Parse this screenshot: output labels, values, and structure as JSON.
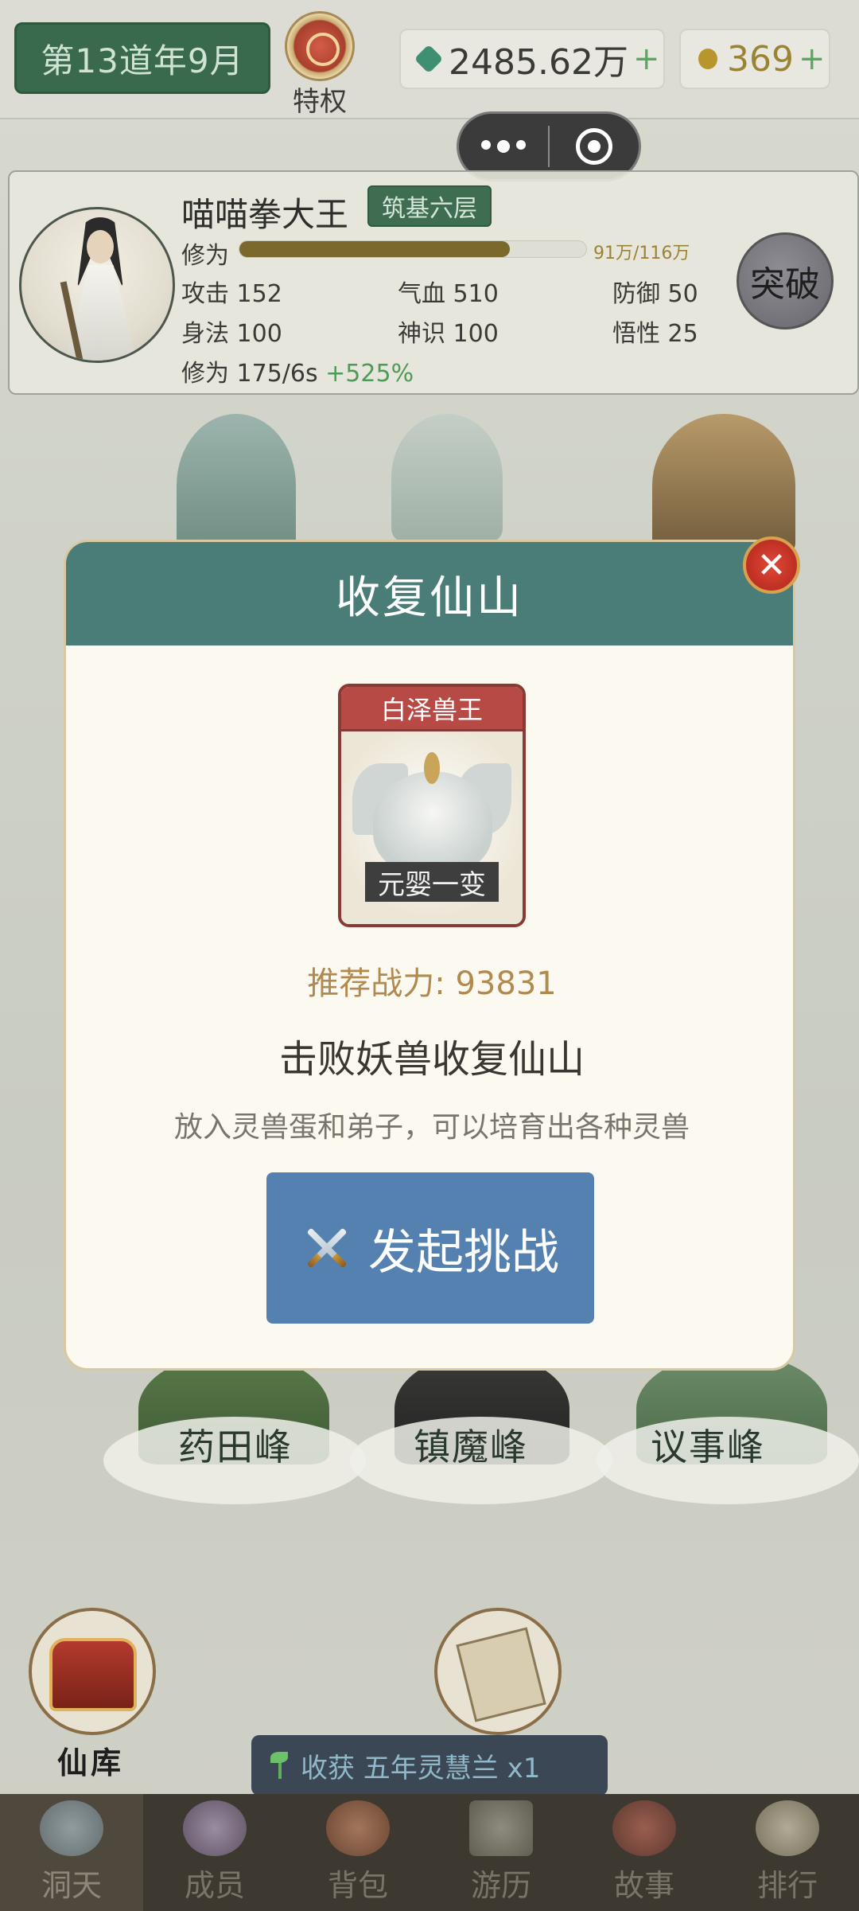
{
  "top_bar": {
    "date": "第13道年9月",
    "privilege_label": "特权",
    "jade_amount": "2485.62万",
    "jade_plus": "+",
    "gold_amount": "369",
    "gold_plus": "+"
  },
  "player": {
    "name": "喵喵拳大王",
    "realm": "筑基六层",
    "xiuwei_label": "修为",
    "xp_progress": 0.78,
    "xp_text": "91万/116万",
    "stats": {
      "attack": "攻击 152",
      "hp": "气血 510",
      "defense": "防御 50",
      "agility": "身法 100",
      "spirit": "神识 100",
      "comprehension": "悟性 25",
      "rate": "修为 175/6s",
      "rate_bonus": "+525%"
    },
    "breakthrough_label": "突破"
  },
  "peaks": {
    "yaotian": "药田峰",
    "zhenmo": "镇魔峰",
    "yishi": "议事峰"
  },
  "modal": {
    "title": "收复仙山",
    "close_icon": "✕",
    "beast_name": "白泽兽王",
    "beast_realm": "元婴一变",
    "recommended_power": "推荐战力: 93831",
    "desc_title": "击败妖兽收复仙山",
    "desc": "放入灵兽蛋和弟子，可以培育出各种灵兽",
    "challenge_label": "发起挑战"
  },
  "features": {
    "treasury_label": "仙库"
  },
  "toast": {
    "text": "收获 五年灵慧兰 x1"
  },
  "nav": [
    {
      "label": "洞天",
      "icon": "cave-icon"
    },
    {
      "label": "成员",
      "icon": "members-icon"
    },
    {
      "label": "背包",
      "icon": "bag-icon"
    },
    {
      "label": "游历",
      "icon": "travel-icon"
    },
    {
      "label": "故事",
      "icon": "story-icon"
    },
    {
      "label": "排行",
      "icon": "ranking-icon"
    }
  ],
  "colors": {
    "modal_header": "#4a7d78",
    "challenge_button": "#5581b0",
    "realm_badge": "#3f6d52",
    "nav_bg": "#3e3930"
  }
}
